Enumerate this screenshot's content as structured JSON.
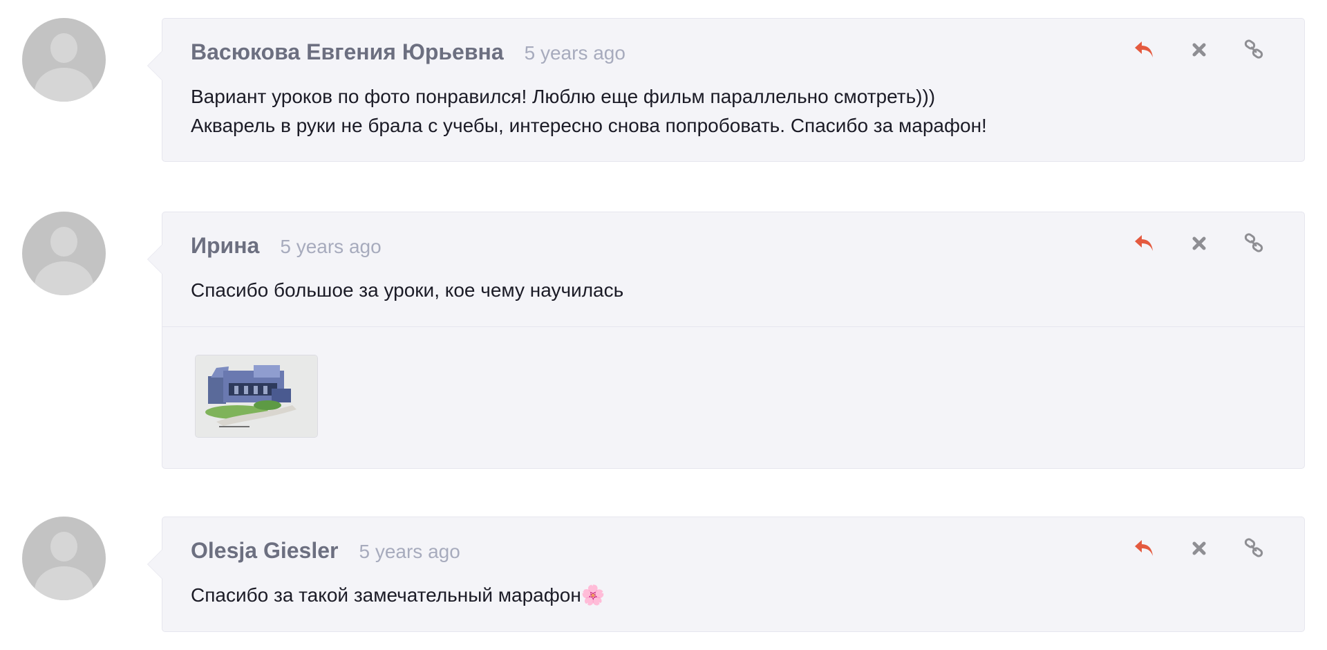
{
  "colors": {
    "reply_icon": "#e45a3f",
    "action_icon": "#8e8e93",
    "author": "#6c6f80",
    "timestamp": "#a7abbd",
    "text": "#1b1b26",
    "bubble_bg": "#f4f4f8"
  },
  "icons": {
    "reply": "reply-arrow-icon",
    "delete": "close-x-icon",
    "permalink": "chain-link-icon",
    "avatar": "default-user-avatar"
  },
  "comments": [
    {
      "author": "Васюкова Евгения Юрьевна",
      "time": "5 years ago",
      "text_lines": [
        "Вариант уроков по фото понравился! Люблю еще фильм параллельно смотреть)))",
        "Акварель в руки не брала с учебы, интересно снова попробовать. Спасибо за марафон!"
      ]
    },
    {
      "author": "Ирина",
      "time": "5 years ago",
      "text_lines": [
        "Спасибо большое за уроки, кое чему научилась"
      ],
      "attachment": "watercolor-building-thumbnail"
    },
    {
      "author": "Olesja Giesler",
      "time": "5 years ago",
      "text_lines": [
        "Спасибо за такой замечательный марафон🌸"
      ]
    }
  ]
}
